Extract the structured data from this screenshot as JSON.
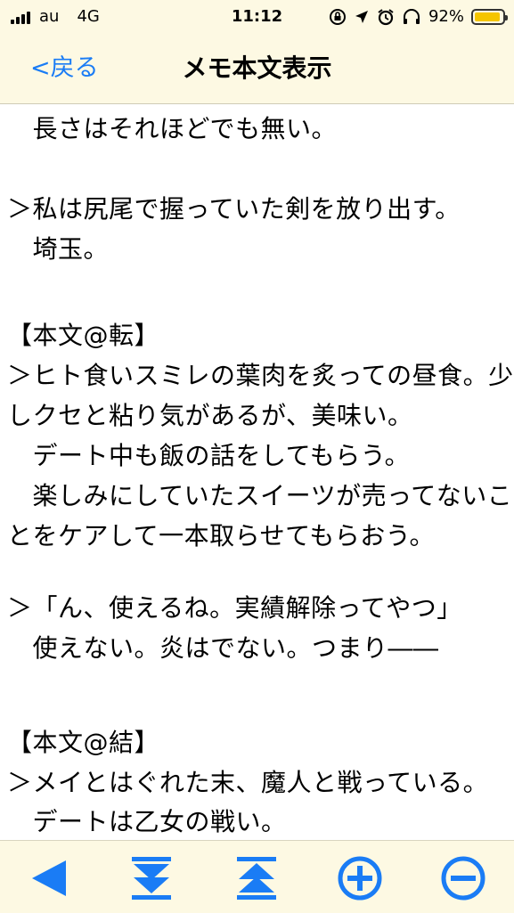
{
  "status_bar": {
    "carrier": "au",
    "network": "4G",
    "time": "11:12",
    "battery_percent": "92%",
    "battery_level": 0.92
  },
  "nav": {
    "back_label": "<戻る",
    "title": "メモ本文表示"
  },
  "content": {
    "lines": [
      "　長さはそれほどでも無い。",
      "",
      "＞私は尻尾で握っていた剣を放り出す。",
      "　埼玉。",
      "",
      "",
      "【本文@転】",
      "＞ヒト食いスミレの葉肉を炙っての昼食。少",
      "しクセと粘り気があるが、美味い。",
      "　デート中も飯の話をしてもらう。",
      "　楽しみにしていたスイーツが売ってないこ",
      "とをケアして一本取らせてもらおう。",
      "",
      "＞「ん、使えるね。実績解除ってやつ」",
      "　使えない。炎はでない。つまり――",
      "",
      "",
      "【本文@結】",
      "＞メイとはぐれた末、魔人と戦っている。",
      "　デートは乙女の戦い。"
    ]
  },
  "toolbar": {
    "buttons": [
      {
        "name": "back-triangle-button",
        "icon": "left-triangle-icon"
      },
      {
        "name": "scroll-bottom-button",
        "icon": "scroll-to-bottom-icon"
      },
      {
        "name": "scroll-top-button",
        "icon": "scroll-to-top-icon"
      },
      {
        "name": "zoom-in-button",
        "icon": "plus-circle-icon"
      },
      {
        "name": "zoom-out-button",
        "icon": "minus-circle-icon"
      }
    ],
    "accent_color": "#1a7cf5"
  },
  "colors": {
    "bar_background": "#fdf9e3",
    "link": "#1a7cf5",
    "battery": "#f5c500"
  }
}
